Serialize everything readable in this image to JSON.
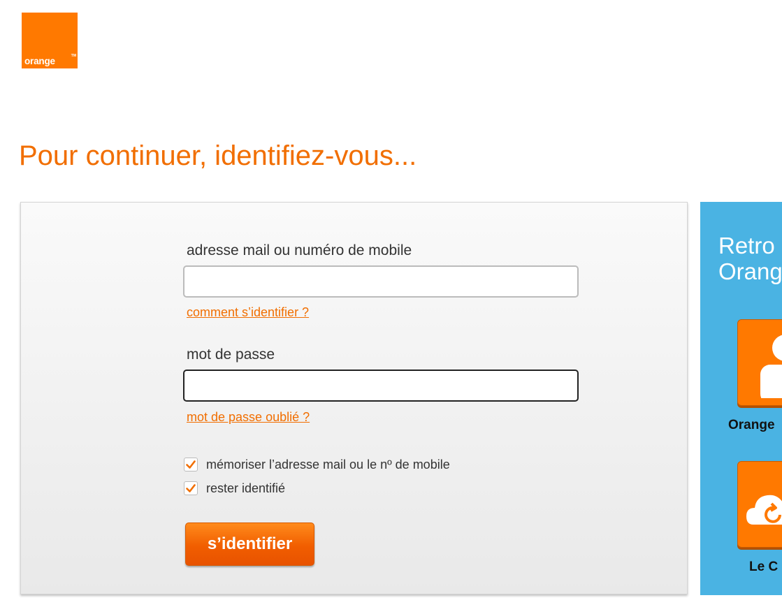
{
  "brand": {
    "logo_text": "orange",
    "accent": "#f16e00",
    "brand_orange": "#ff7900"
  },
  "page": {
    "title": "Pour continuer, identifiez-vous..."
  },
  "form": {
    "login_label": "adresse mail ou numéro de mobile",
    "login_value": "",
    "login_help": "comment s’identifier ?",
    "password_label": "mot de passe",
    "password_value": "",
    "password_help": "mot de passe oublié ?",
    "remember_label": "mémoriser l’adresse mail ou le nº de mobile",
    "remember_checked": true,
    "stay_label": "rester identifié",
    "stay_checked": true,
    "submit_label": "s’identifier"
  },
  "side_panel": {
    "background": "#4ab3e3",
    "title_line1": "Retro",
    "title_line2": "Orang",
    "apps": [
      {
        "icon": "user-icon",
        "caption": "Orange"
      },
      {
        "icon": "cloud-sync-icon",
        "caption": "Le C"
      }
    ]
  }
}
